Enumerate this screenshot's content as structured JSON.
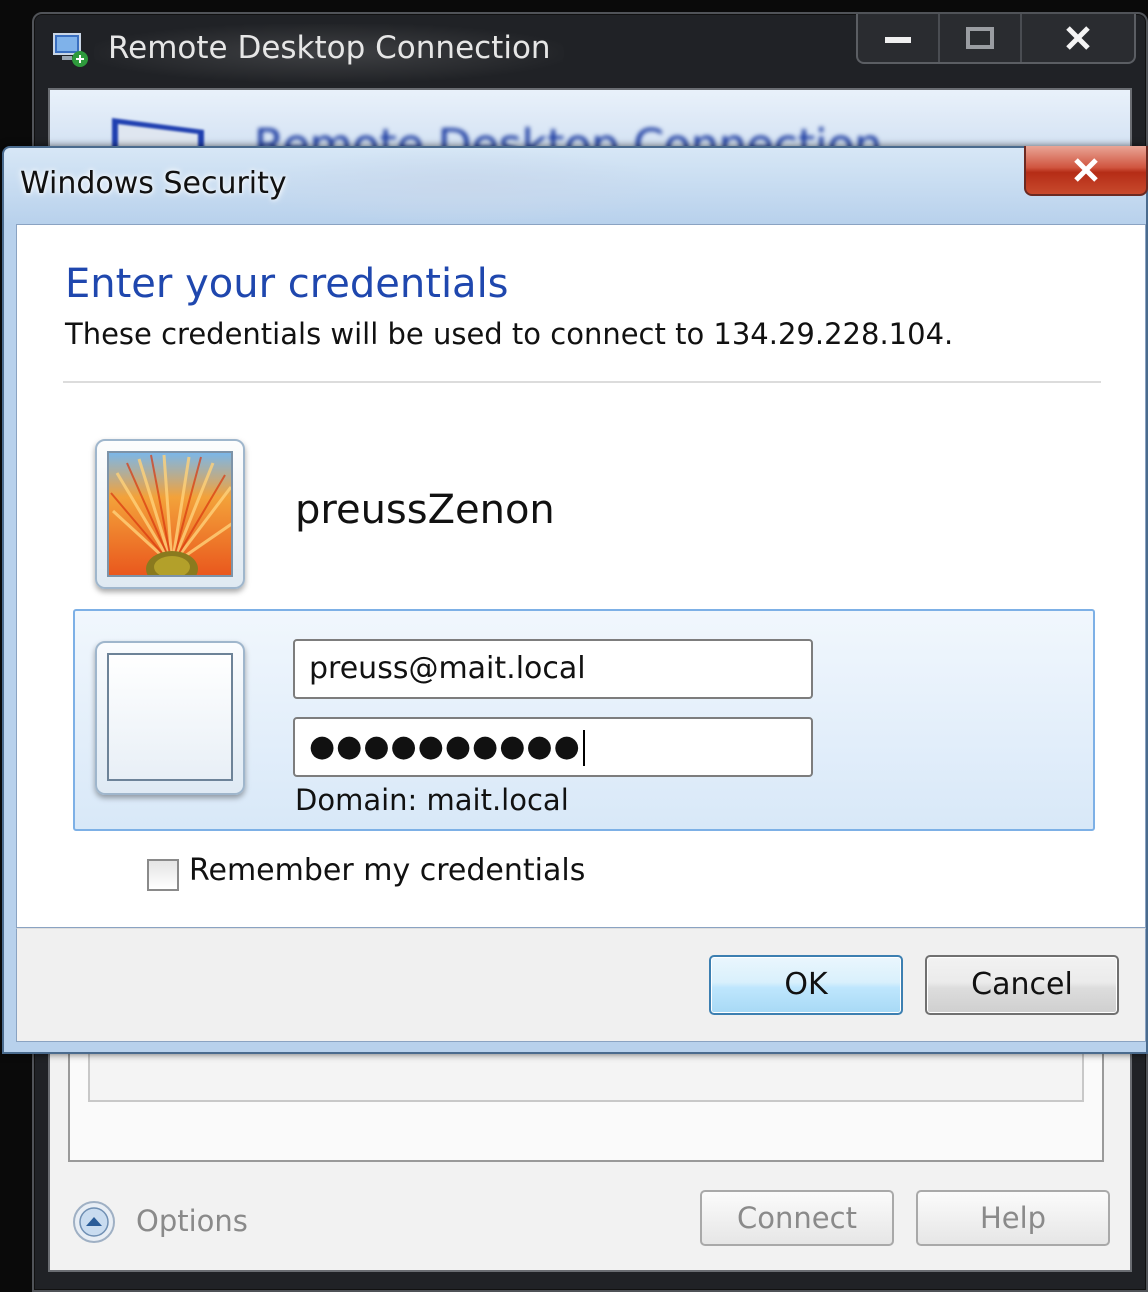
{
  "background_window": {
    "title": "Remote Desktop Connection",
    "banner_text": "Remote Desktop Connection",
    "options_label": "Options",
    "connect_label": "Connect",
    "help_label": "Help"
  },
  "dialog": {
    "title": "Windows Security",
    "heading": "Enter your credentials",
    "subheading": "These credentials will be used to connect to 134.29.228.104.",
    "user_name": "preussZenon",
    "username_value": "preuss@mait.local",
    "password_mask": "●●●●●●●●●●",
    "domain_label": "Domain: mait.local",
    "remember_label": "Remember my credentials",
    "remember_checked": false,
    "ok_label": "OK",
    "cancel_label": "Cancel"
  },
  "icons": {
    "rdc_app": "remote-desktop-icon",
    "minimize": "minimize-icon",
    "maximize": "maximize-icon",
    "close": "close-icon",
    "options": "chevron-up-icon",
    "user_picture": "flower-user-picture"
  },
  "colors": {
    "heading_blue": "#1f47ae",
    "ok_border": "#3c7fb1",
    "close_red": "#c84a2d",
    "panel_border": "#7db0e6"
  }
}
